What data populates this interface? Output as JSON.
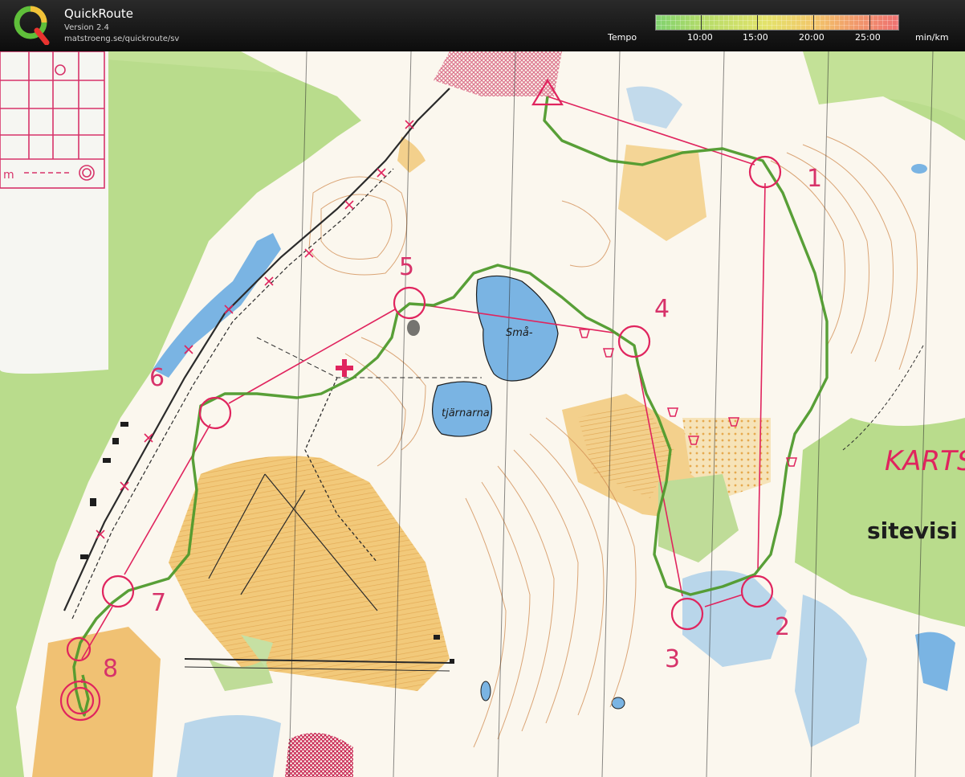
{
  "app": {
    "title": "QuickRoute",
    "version": "Version 2.4",
    "url": "matstroeng.se/quickroute/sv"
  },
  "tempo_scale": {
    "label": "Tempo",
    "ticks": [
      "10:00",
      "15:00",
      "20:00",
      "25:00"
    ],
    "unit": "min/km",
    "colors": [
      "#7fd26e",
      "#e3e36a",
      "#f19a6b",
      "#ee7070"
    ]
  },
  "map": {
    "lake_name_1": "Små-",
    "lake_name_2": "tjärnarna",
    "sign_text_1": "KARTS",
    "sign_text_2": "sitevisi",
    "legend_label": "m",
    "controls": [
      {
        "number": "1"
      },
      {
        "number": "2"
      },
      {
        "number": "3"
      },
      {
        "number": "4"
      },
      {
        "number": "5"
      },
      {
        "number": "6"
      },
      {
        "number": "7"
      },
      {
        "number": "8"
      }
    ],
    "colors": {
      "course": "#e0245e",
      "route": "#4f9a2c",
      "water": "#7ab4e3",
      "open_land": "#f0c173",
      "green_bg": "#b9dc8c",
      "paper": "#fbf7ee"
    }
  }
}
